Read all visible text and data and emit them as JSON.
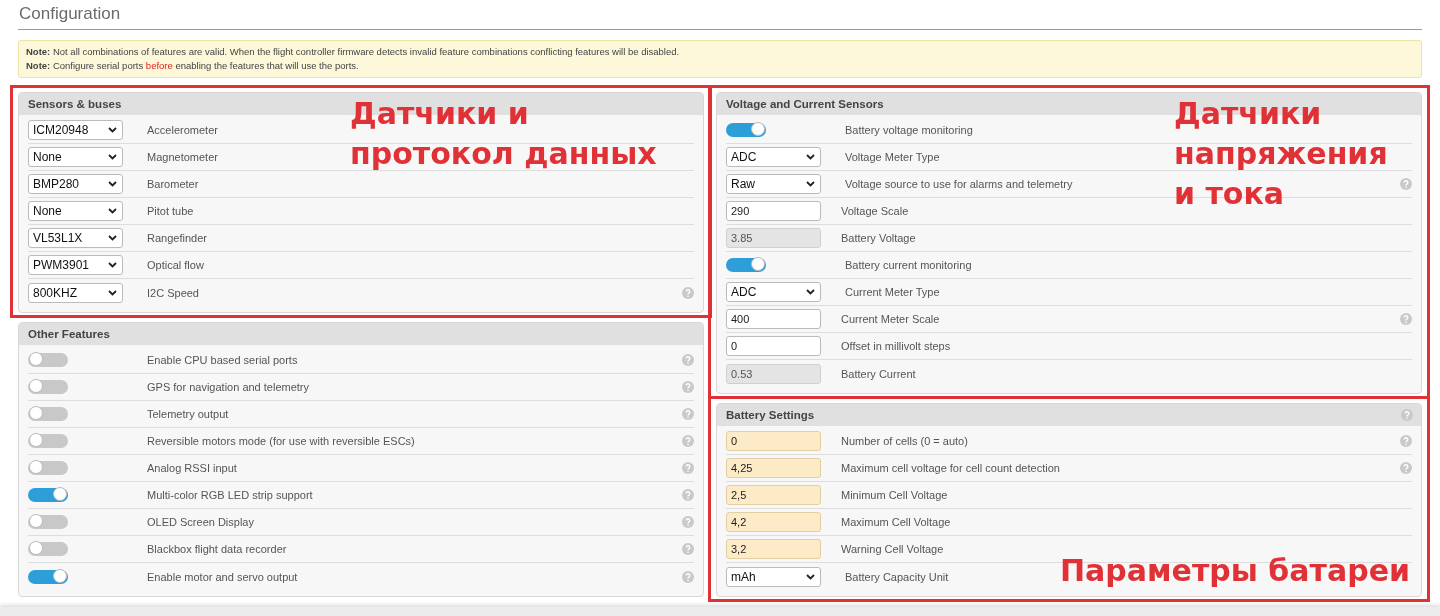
{
  "title": "Configuration",
  "notes": [
    {
      "label": "Note:",
      "text": "Not all combinations of features are valid. When the flight controller firmware detects invalid feature combinations conflicting features will be disabled."
    },
    {
      "label": "Note:",
      "text": "Configure serial ports ",
      "highlight": "before",
      "after": " enabling the features that will use the ports."
    }
  ],
  "columns": [
    {
      "panels": [
        {
          "title": "Sensors & buses",
          "help": false,
          "annotation": "Датчики и\nпротокол данных",
          "rows": [
            {
              "kind": "select",
              "value": "ICM20948",
              "label": "Accelerometer",
              "help": false
            },
            {
              "kind": "select",
              "value": "None",
              "label": "Magnetometer",
              "help": false
            },
            {
              "kind": "select",
              "value": "BMP280",
              "label": "Barometer",
              "help": false
            },
            {
              "kind": "select",
              "value": "None",
              "label": "Pitot tube",
              "help": false
            },
            {
              "kind": "select",
              "value": "VL53L1X",
              "label": "Rangefinder",
              "help": false
            },
            {
              "kind": "select",
              "value": "PWM3901",
              "label": "Optical flow",
              "help": false
            },
            {
              "kind": "select",
              "value": "800KHZ",
              "label": "I2C Speed",
              "help": true
            }
          ]
        },
        {
          "title": "Other Features",
          "help": false,
          "rows": [
            {
              "kind": "toggle",
              "on": false,
              "label": "Enable CPU based serial ports",
              "help": true
            },
            {
              "kind": "toggle",
              "on": false,
              "label": "GPS for navigation and telemetry",
              "help": true
            },
            {
              "kind": "toggle",
              "on": false,
              "label": "Telemetry output",
              "help": true
            },
            {
              "kind": "toggle",
              "on": false,
              "label": "Reversible motors mode (for use with reversible ESCs)",
              "help": true
            },
            {
              "kind": "toggle",
              "on": false,
              "label": "Analog RSSI input",
              "help": true
            },
            {
              "kind": "toggle",
              "on": true,
              "label": "Multi-color RGB LED strip support",
              "help": true
            },
            {
              "kind": "toggle",
              "on": false,
              "label": "OLED Screen Display",
              "help": true
            },
            {
              "kind": "toggle",
              "on": false,
              "label": "Blackbox flight data recorder",
              "help": true
            },
            {
              "kind": "toggle",
              "on": true,
              "label": "Enable motor and servo output",
              "help": true
            }
          ]
        }
      ]
    },
    {
      "panels": [
        {
          "title": "Voltage and Current Sensors",
          "help": false,
          "annotation": "Датчики\nнапряжения\nи тока",
          "rows": [
            {
              "kind": "toggle",
              "on": true,
              "label": "Battery voltage monitoring",
              "help": false
            },
            {
              "kind": "select",
              "value": "ADC",
              "label": "Voltage Meter Type",
              "help": false
            },
            {
              "kind": "select",
              "value": "Raw",
              "label": "Voltage source to use for alarms and telemetry",
              "help": true
            },
            {
              "kind": "input",
              "value": "290",
              "label": "Voltage Scale",
              "help": false,
              "modified": false
            },
            {
              "kind": "readout",
              "value": "3.85",
              "label": "Battery Voltage",
              "help": false
            },
            {
              "kind": "toggle",
              "on": true,
              "label": "Battery current monitoring",
              "help": false
            },
            {
              "kind": "select",
              "value": "ADC",
              "label": "Current Meter Type",
              "help": false
            },
            {
              "kind": "input",
              "value": "400",
              "label": "Current Meter Scale",
              "help": true,
              "modified": false
            },
            {
              "kind": "input",
              "value": "0",
              "label": "Offset in millivolt steps",
              "help": false,
              "modified": false
            },
            {
              "kind": "readout",
              "value": "0.53",
              "label": "Battery Current",
              "help": false
            }
          ]
        },
        {
          "title": "Battery Settings",
          "help": true,
          "annotation": "Параметры батареи",
          "rows": [
            {
              "kind": "input",
              "value": "0",
              "label": "Number of cells (0 = auto)",
              "help": true,
              "modified": true
            },
            {
              "kind": "input",
              "value": "4,25",
              "label": "Maximum cell voltage for cell count detection",
              "help": true,
              "modified": true
            },
            {
              "kind": "input",
              "value": "2,5",
              "label": "Minimum Cell Voltage",
              "help": false,
              "modified": true
            },
            {
              "kind": "input",
              "value": "4,2",
              "label": "Maximum Cell Voltage",
              "help": false,
              "modified": true
            },
            {
              "kind": "input",
              "value": "3,2",
              "label": "Warning Cell Voltage",
              "help": false,
              "modified": true
            },
            {
              "kind": "select",
              "value": "mAh",
              "label": "Battery Capacity Unit",
              "help": false
            }
          ]
        }
      ]
    }
  ]
}
